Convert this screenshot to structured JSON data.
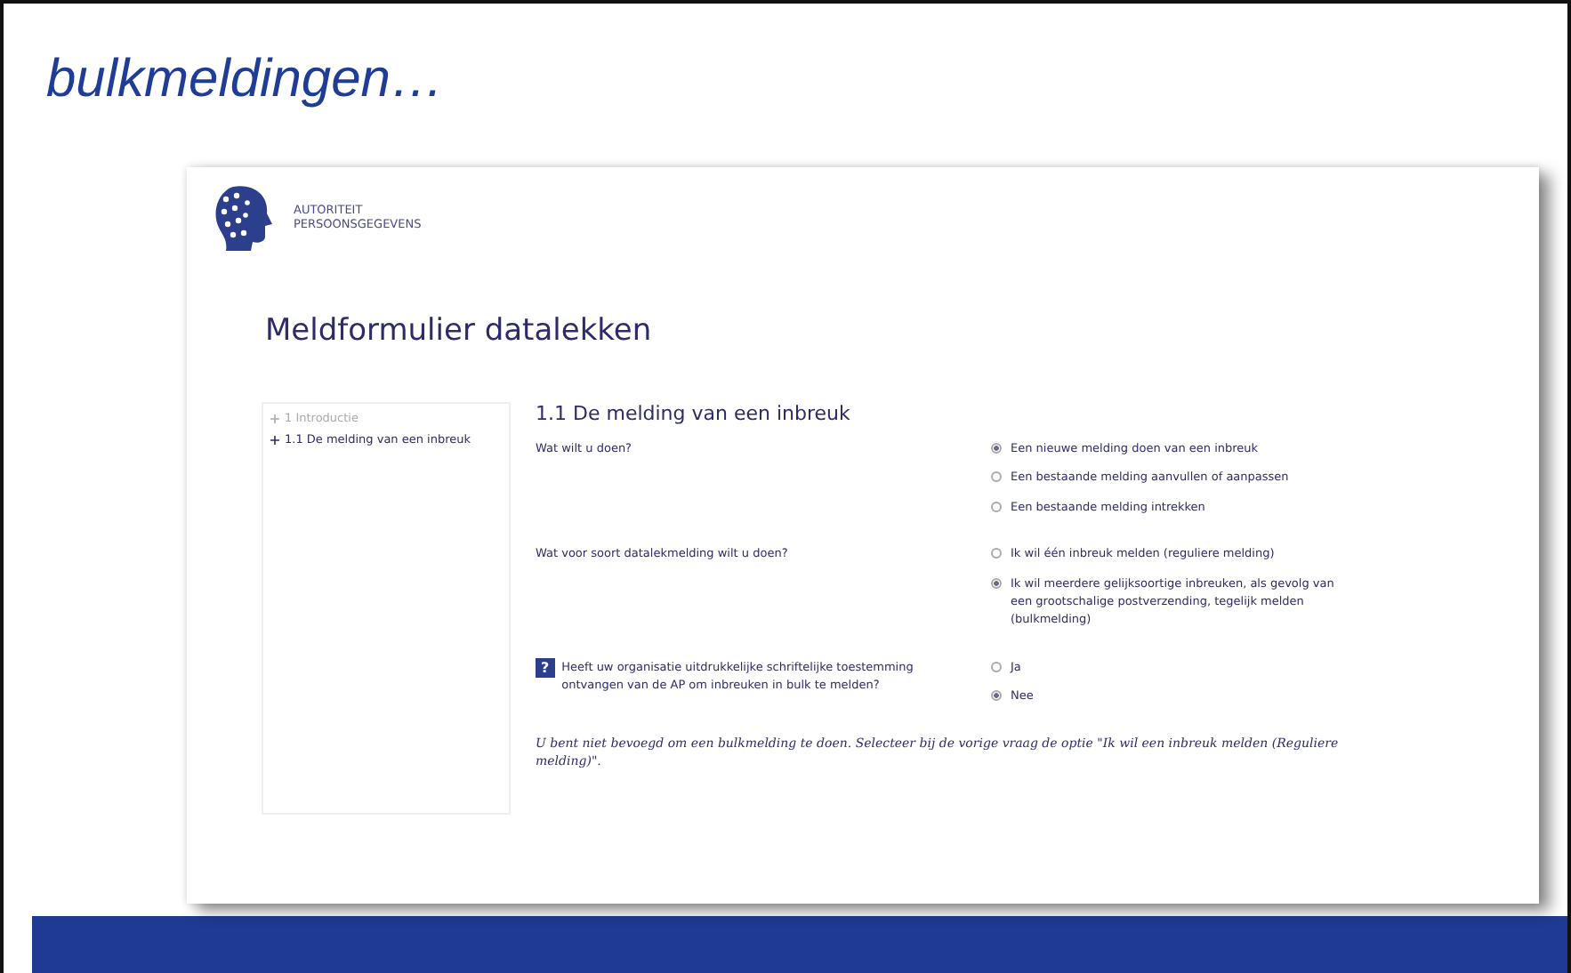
{
  "slide": {
    "title": "bulkmeldingen…"
  },
  "page": {
    "brand": [
      "AUTORITEIT",
      "PERSOONSGEGEVENS"
    ],
    "form_title": "Meldformulier datalekken",
    "sidebar": {
      "items": [
        {
          "label": "1 Introductie",
          "selected": false
        },
        {
          "label": "1.1 De melding van een inbreuk",
          "selected": true
        }
      ]
    },
    "section_title": "1.1 De melding van een inbreuk",
    "questions": [
      {
        "label": "Wat wilt u doen?",
        "options": [
          {
            "label": "Een nieuwe melding doen van een inbreuk",
            "selected": true
          },
          {
            "label": "Een bestaande melding aanvullen of aanpassen",
            "selected": false
          },
          {
            "label": "Een bestaande melding intrekken",
            "selected": false
          }
        ]
      },
      {
        "label": "Wat voor soort datalekmelding wilt u doen?",
        "options": [
          {
            "label": "Ik wil één inbreuk melden (reguliere melding)",
            "selected": false
          },
          {
            "label": "Ik wil meerdere gelijksoortige inbreuken, als gevolg van een grootschalige postverzending, tegelijk melden (bulkmelding)",
            "selected": true
          }
        ]
      },
      {
        "help": "?",
        "label": "Heeft uw organisatie uitdrukkelijke schriftelijke toestemming ontvangen van de AP om inbreuken in bulk te melden?",
        "options": [
          {
            "label": "Ja",
            "selected": false
          },
          {
            "label": "Nee",
            "selected": true
          }
        ]
      }
    ],
    "notice": "U bent niet bevoegd om een bulkmelding te doen. Selecteer bij de vorige vraag de optie \"Ik wil een inbreuk melden (Reguliere melding)\"."
  }
}
